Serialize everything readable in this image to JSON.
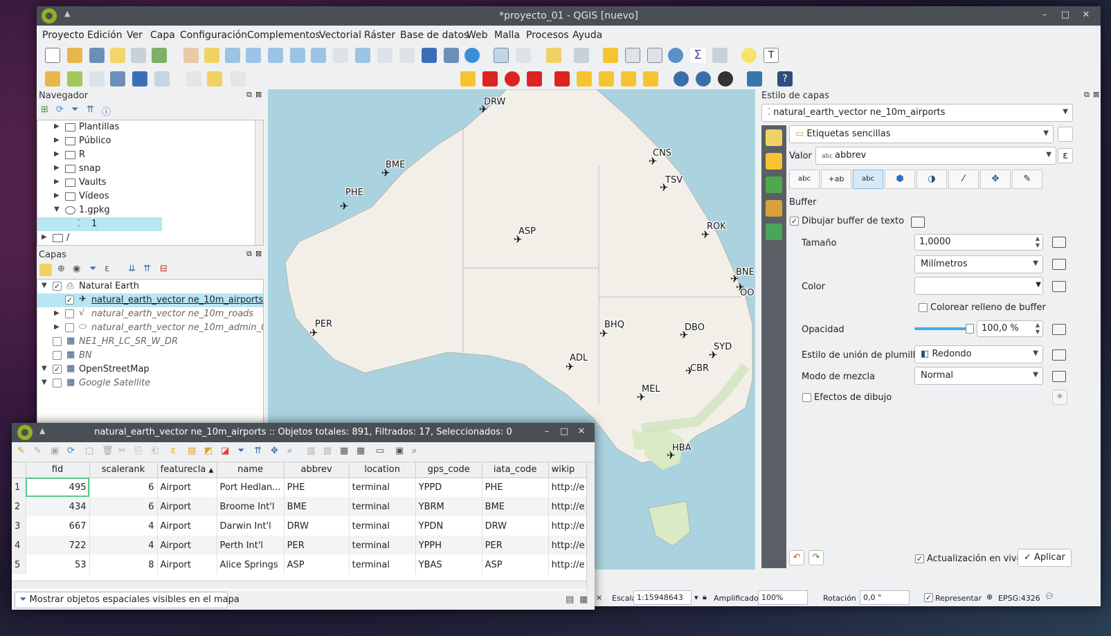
{
  "window": {
    "title": "*proyecto_01 - QGIS [nuevo]"
  },
  "menu": [
    "Proyecto",
    "Edición",
    "Ver",
    "Capa",
    "Configuración",
    "Complementos",
    "Vectorial",
    "Ráster",
    "Base de datos",
    "Web",
    "Malla",
    "Procesos",
    "Ayuda"
  ],
  "browser": {
    "title": "Navegador",
    "items": [
      "Plantillas",
      "Público",
      "R",
      "snap",
      "Vaults",
      "Vídeos",
      "1.gpkg",
      "1",
      "/"
    ]
  },
  "layers": {
    "title": "Capas",
    "items": [
      {
        "label": "Natural Earth",
        "checked": "✓"
      },
      {
        "label": "natural_earth_vector ne_10m_airports",
        "checked": "✓"
      },
      {
        "label": "natural_earth_vector ne_10m_roads",
        "checked": ""
      },
      {
        "label": "natural_earth_vector ne_10m_admin_0_c",
        "checked": ""
      },
      {
        "label": "NE1_HR_LC_SR_W_DR",
        "checked": ""
      },
      {
        "label": "BN",
        "checked": ""
      },
      {
        "label": "OpenStreetMap",
        "checked": "✓"
      },
      {
        "label": "Google Satellite",
        "checked": ""
      }
    ]
  },
  "map": {
    "airports": [
      {
        "code": "DRW"
      },
      {
        "code": "BME"
      },
      {
        "code": "PHE"
      },
      {
        "code": "CNS"
      },
      {
        "code": "TSV"
      },
      {
        "code": "ASP"
      },
      {
        "code": "ROK"
      },
      {
        "code": "BNE"
      },
      {
        "code": "OO"
      },
      {
        "code": "PER"
      },
      {
        "code": "BHQ"
      },
      {
        "code": "DBO"
      },
      {
        "code": "SYD"
      },
      {
        "code": "ADL"
      },
      {
        "code": "CBR"
      },
      {
        "code": "MEL"
      },
      {
        "code": "HBA"
      }
    ]
  },
  "style_panel": {
    "title": "Estilo de capas",
    "layer": "natural_earth_vector ne_10m_airports",
    "label_mode": "Etiquetas sencillas",
    "value_label": "Valor",
    "value": "abbrev",
    "section": "Buffer",
    "draw_buffer": "Dibujar buffer de texto",
    "size_label": "Tamaño",
    "size_value": "1,0000",
    "units": "Milímetros",
    "color_label": "Color",
    "color_fill": "Colorear relleno de buffer",
    "opacity_label": "Opacidad",
    "opacity_value": "100,0 %",
    "opacity_level": 1.0,
    "join_label": "Estilo de unión de plumilla",
    "join_value": "Redondo",
    "blend_label": "Modo de mezcla",
    "blend_value": "Normal",
    "effects": "Efectos de dibujo",
    "live_update": "Actualización en vivo",
    "apply": "Aplicar"
  },
  "statusbar": {
    "scale_label": "Escala",
    "scale_value": "1:15948643",
    "magnifier_label": "Amplificador",
    "magnifier_value": "100%",
    "rotation_label": "Rotación",
    "rotation_value": "0,0 °",
    "render_label": "Representar",
    "crs": "EPSG:4326"
  },
  "attr_table": {
    "title": "natural_earth_vector ne_10m_airports :: Objetos totales: 891, Filtrados: 17, Seleccionados: 0",
    "columns": [
      "fid",
      "scalerank",
      "featurecla",
      "name",
      "abbrev",
      "location",
      "gps_code",
      "iata_code",
      "wikip"
    ],
    "rows": [
      [
        "1",
        "495",
        "6",
        "Airport",
        "Port Hedlan...",
        "PHE",
        "terminal",
        "YPPD",
        "PHE",
        "http://e"
      ],
      [
        "2",
        "434",
        "6",
        "Airport",
        "Broome Int'l",
        "BME",
        "terminal",
        "YBRM",
        "BME",
        "http://e"
      ],
      [
        "3",
        "667",
        "4",
        "Airport",
        "Darwin Int'l",
        "DRW",
        "terminal",
        "YPDN",
        "DRW",
        "http://e"
      ],
      [
        "4",
        "722",
        "4",
        "Airport",
        "Perth Int'l",
        "PER",
        "terminal",
        "YPPH",
        "PER",
        "http://e"
      ],
      [
        "5",
        "53",
        "8",
        "Airport",
        "Alice Springs",
        "ASP",
        "terminal",
        "YBAS",
        "ASP",
        "http://e"
      ]
    ],
    "filter_button": "Mostrar objetos espaciales visibles en el mapa"
  },
  "colors": {
    "titlebar": "#4a4f55",
    "accent": "#93b023",
    "selection": "#b8e6f2",
    "water": "#aad3df",
    "land": "#f2efe9"
  }
}
